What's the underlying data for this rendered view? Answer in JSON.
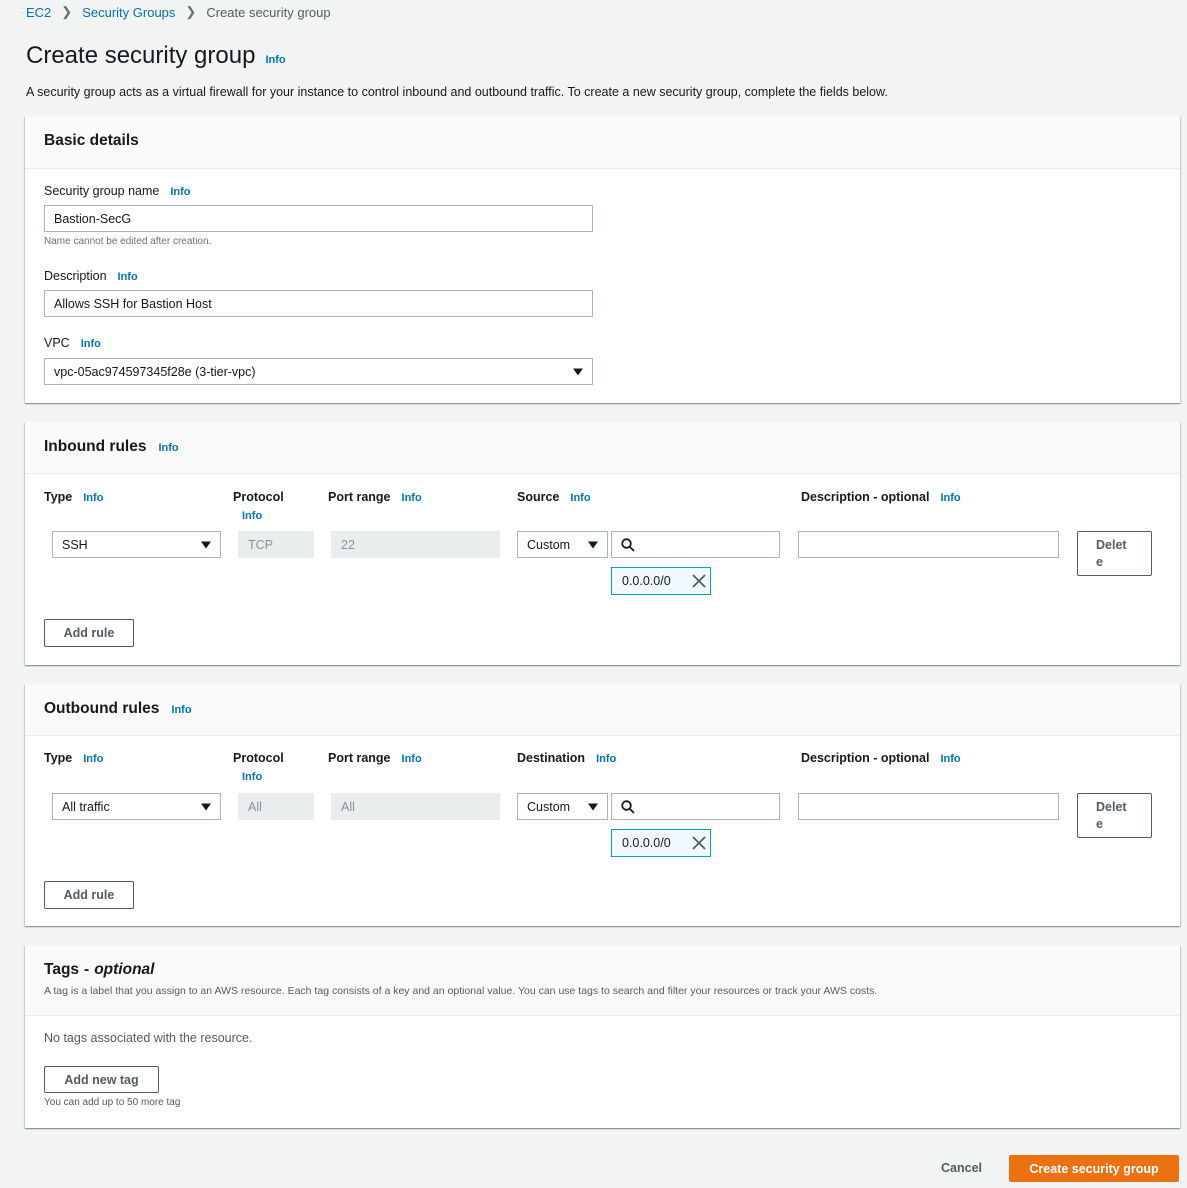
{
  "breadcrumb": {
    "items": [
      "EC2",
      "Security Groups"
    ],
    "current": "Create security group"
  },
  "page": {
    "title": "Create security group",
    "info": "Info",
    "description": "A security group acts as a virtual firewall for your instance to control inbound and outbound traffic. To create a new security group, complete the fields below."
  },
  "basic": {
    "title": "Basic details",
    "name_label": "Security group name",
    "name_value": "Bastion-SecG",
    "name_hint": "Name cannot be edited after creation.",
    "desc_label": "Description",
    "desc_value": "Allows SSH for Bastion Host",
    "vpc_label": "VPC",
    "vpc_value": "vpc-05ac974597345f28e (3-tier-vpc)"
  },
  "info": "Info",
  "inbound": {
    "title": "Inbound rules",
    "col_type": "Type",
    "col_protocol": "Protocol",
    "col_port": "Port range",
    "col_target": "Source",
    "col_desc": "Description - optional",
    "rule": {
      "type": "SSH",
      "protocol": "TCP",
      "port": "22",
      "source_mode": "Custom",
      "search": "",
      "cidr": "0.0.0.0/0",
      "description": ""
    },
    "delete_line1": "Delet",
    "delete_line2": "e",
    "add_rule": "Add rule"
  },
  "outbound": {
    "title": "Outbound rules",
    "col_type": "Type",
    "col_protocol": "Protocol",
    "col_port": "Port range",
    "col_target": "Destination",
    "col_desc": "Description - optional",
    "rule": {
      "type": "All traffic",
      "protocol": "All",
      "port": "All",
      "source_mode": "Custom",
      "search": "",
      "cidr": "0.0.0.0/0",
      "description": ""
    },
    "delete_line1": "Delet",
    "delete_line2": "e",
    "add_rule": "Add rule"
  },
  "tags": {
    "title": "Tags",
    "title_suffix": "optional",
    "subtitle": "A tag is a label that you assign to an AWS resource. Each tag consists of a key and an optional value. You can use tags to search and filter your resources or track your AWS costs.",
    "empty": "No tags associated with the resource.",
    "add_button": "Add new tag",
    "limit_hint": "You can add up to 50 more tag"
  },
  "footer": {
    "cancel": "Cancel",
    "submit": "Create security group"
  },
  "colors": {
    "link": "#0073bb",
    "primary": "#ec7211",
    "token_border": "#00a1c9"
  }
}
